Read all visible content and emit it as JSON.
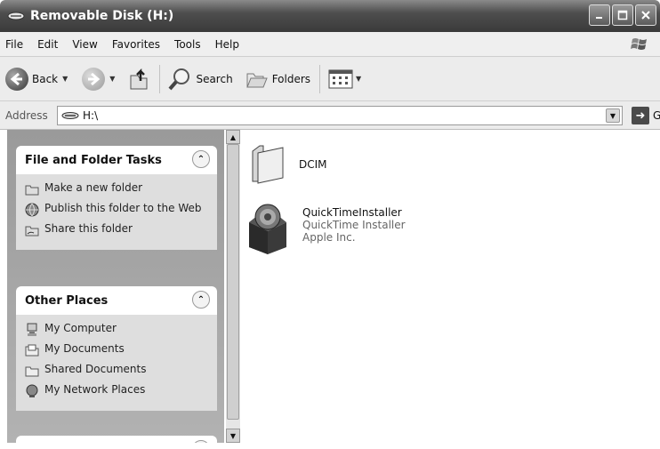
{
  "window": {
    "title": "Removable Disk (H:)"
  },
  "menu": [
    "File",
    "Edit",
    "View",
    "Favorites",
    "Tools",
    "Help"
  ],
  "toolbar": {
    "back": "Back",
    "search": "Search",
    "folders": "Folders"
  },
  "address": {
    "label": "Address",
    "value": "H:\\",
    "go": "Go"
  },
  "tasks_panel": {
    "title": "File and Folder Tasks",
    "items": [
      "Make a new folder",
      "Publish this folder to the Web",
      "Share this folder"
    ]
  },
  "places_panel": {
    "title": "Other Places",
    "items": [
      "My Computer",
      "My Documents",
      "Shared Documents",
      "My Network Places"
    ]
  },
  "files": [
    {
      "name": "DCIM",
      "icon": "folder-icon"
    },
    {
      "name": "QuickTimeInstaller",
      "description": "QuickTime Installer",
      "company": "Apple Inc.",
      "icon": "installer-box-icon"
    }
  ]
}
